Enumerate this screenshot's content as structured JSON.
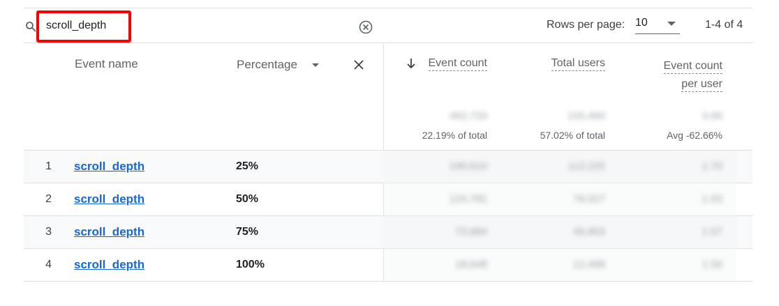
{
  "search": {
    "value": "scroll_depth"
  },
  "pagination": {
    "rows_per_page_label": "Rows per page:",
    "rows_per_page_value": "10",
    "range": "1-4 of 4"
  },
  "table": {
    "columns": {
      "event_name": "Event name",
      "secondary_dimension": "Percentage",
      "event_count": "Event count",
      "total_users": "Total users",
      "event_count_per_user_line1": "Event count",
      "event_count_per_user_line2": "per user"
    },
    "totals": {
      "event_count_value": "492,733",
      "event_count_sub": "22.19% of total",
      "total_users_value": "155,460",
      "total_users_sub": "57.02% of total",
      "per_user_value": "3.66",
      "per_user_sub": "Avg -62.66%"
    },
    "rows": [
      {
        "index": "1",
        "event_name": "scroll_depth",
        "percentage": "25%",
        "event_count": "190,610",
        "total_users": "112,225",
        "per_user": "1.70"
      },
      {
        "index": "2",
        "event_name": "scroll_depth",
        "percentage": "50%",
        "event_count": "124,781",
        "total_users": "76,027",
        "per_user": "1.63"
      },
      {
        "index": "3",
        "event_name": "scroll_depth",
        "percentage": "75%",
        "event_count": "73,684",
        "total_users": "46,903",
        "per_user": "1.57"
      },
      {
        "index": "4",
        "event_name": "scroll_depth",
        "percentage": "100%",
        "event_count": "18,648",
        "total_users": "12,498",
        "per_user": "1.50"
      }
    ]
  },
  "colors": {
    "link": "#1967d2",
    "highlight": "#ff0000",
    "divider": "#e0e0e0"
  },
  "icons": [
    "search-icon",
    "clear-circle-x-icon",
    "chevron-down-icon",
    "close-icon",
    "arrow-down-icon"
  ]
}
